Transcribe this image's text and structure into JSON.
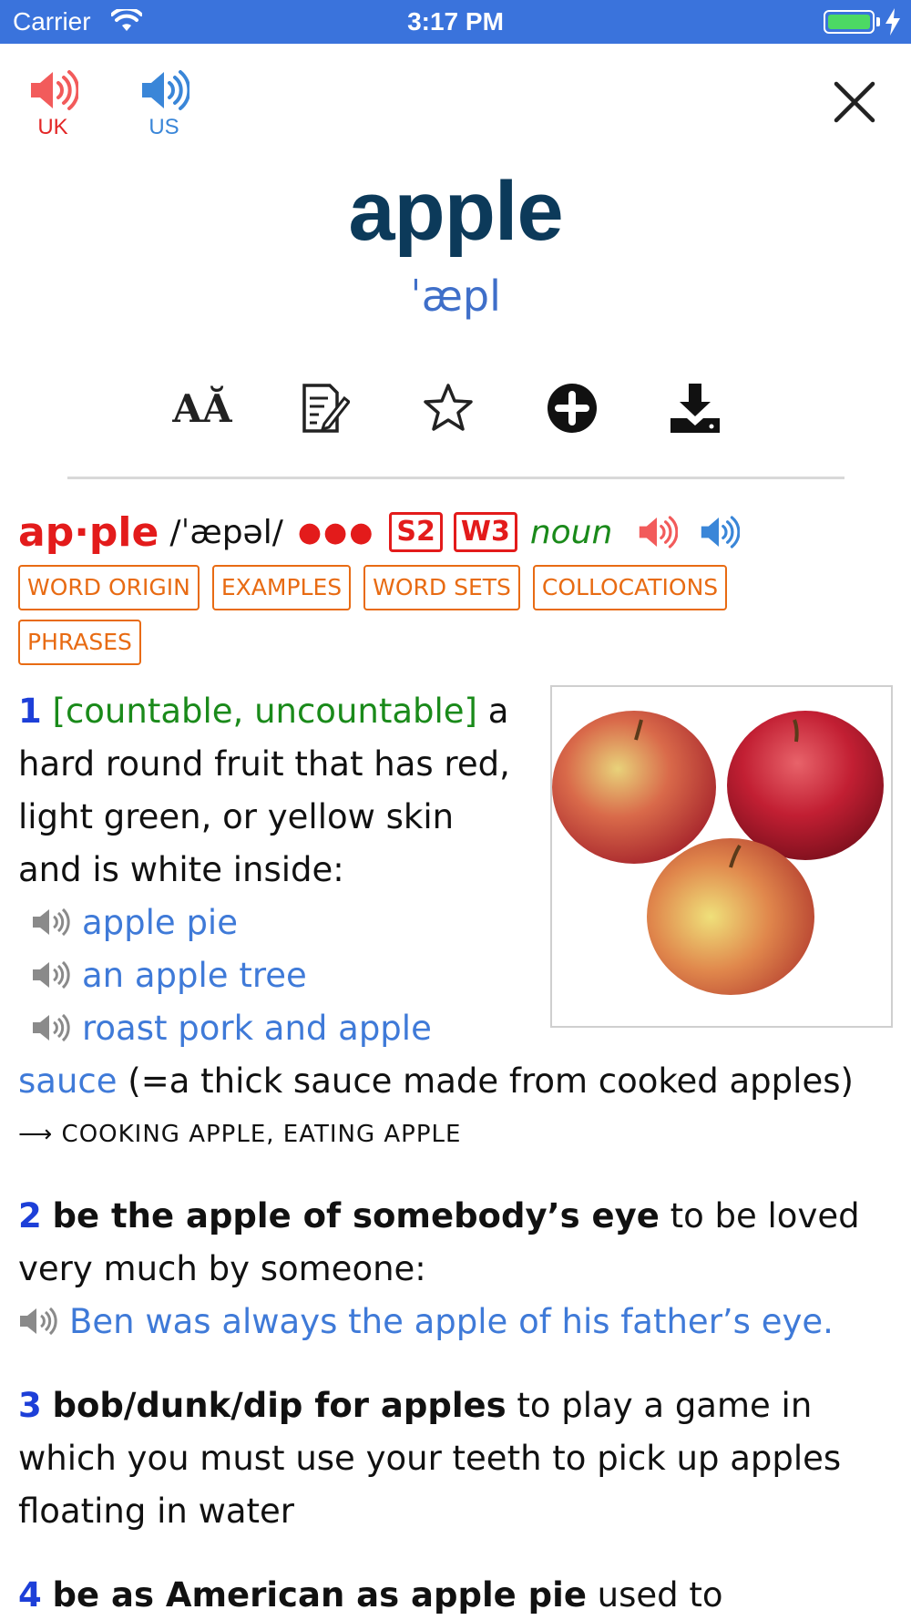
{
  "status_bar": {
    "carrier": "Carrier",
    "time": "3:17 PM"
  },
  "header": {
    "uk_label": "UK",
    "us_label": "US",
    "headword": "apple",
    "phonetic": "ˈæpl",
    "colors": {
      "uk": "#e32626",
      "us": "#3a86d8",
      "headword": "#0c3a5a"
    }
  },
  "toolbar": {
    "font_size_glyph": "AĂ",
    "icons": [
      "font-size-icon",
      "note-icon",
      "star-icon",
      "plus-circle-icon",
      "download-icon"
    ]
  },
  "entry": {
    "headword": "ap·ple",
    "ipa": "/ˈæpəl/",
    "frequency_dots": "●●●",
    "spoken_freq": "S2",
    "written_freq": "W3",
    "part_of_speech": "noun",
    "tags": [
      "WORD ORIGIN",
      "EXAMPLES",
      "WORD SETS",
      "COLLOCATIONS",
      "PHRASES"
    ],
    "senses": [
      {
        "number": "1",
        "grammar": "[countable, uncountable]",
        "def_a": "a",
        "def_lines": [
          "hard round fruit that has red,",
          "light green, or yellow skin",
          "and is white inside:"
        ],
        "examples": [
          "apple pie",
          "an apple tree",
          "roast pork and apple"
        ],
        "example_cont": "sauce",
        "gloss": " (=a thick sauce made from cooked apples)",
        "xref": "⟶ COOKING APPLE, EATING APPLE"
      },
      {
        "number": "2",
        "phrase": "be the apple of somebody’s eye",
        "def_a": " to be loved",
        "def_b": "very much by someone:",
        "example": "Ben was always the apple of his father’s eye."
      },
      {
        "number": "3",
        "phrase": "bob/dunk/dip for apples",
        "def_a": " to play a game in",
        "def_b": "which you must use your teeth to pick up apples",
        "def_c": "floating in water"
      },
      {
        "number": "4",
        "phrase": "be as American as apple pie",
        "def_a": " used to"
      }
    ]
  }
}
